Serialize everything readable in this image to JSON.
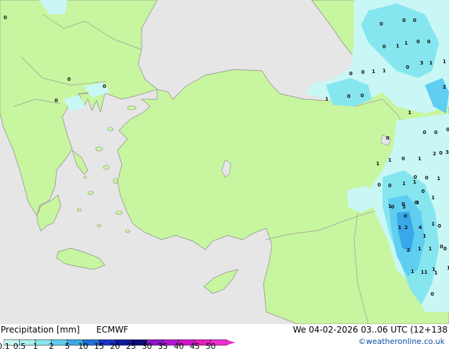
{
  "footer": {
    "title": "Precipitation [mm]",
    "model": "ECMWF",
    "valid_time": "We 04-02-2026 03..06 UTC (12+138",
    "credit": "©weatheronline.co.uk"
  },
  "legend": {
    "ticks": [
      "0.1",
      "0.5",
      "1",
      "2",
      "5",
      "10",
      "15",
      "20",
      "25",
      "30",
      "35",
      "40",
      "45",
      "50"
    ],
    "colors": [
      "#c8f7f5",
      "#aaf0ee",
      "#86e6f0",
      "#5fcef0",
      "#3aa8e8",
      "#1f6fd8",
      "#1832c8",
      "#0c1aa0",
      "#0a0a78",
      "#8c14c8",
      "#b414d2",
      "#d214c8",
      "#e61ebe",
      "#f02dd2"
    ]
  },
  "map_colors": {
    "sea": "#e6e6e6",
    "land": "#c8f5a0",
    "border": "#8a8a8a",
    "precip_light": "#c8f7f5",
    "precip_mid": "#86e6f0",
    "precip_heavy": "#5fcef0",
    "precip_strong": "#3aa8e8"
  },
  "map_labels": [
    "0",
    "0",
    "0",
    "0",
    "0",
    "0",
    "1",
    "1",
    "0",
    "0",
    "1",
    "0",
    "0",
    "0",
    "1",
    "1",
    "0",
    "3",
    "1",
    "2",
    "0",
    "0",
    "1",
    "0",
    "0",
    "1",
    "0",
    "0",
    "0",
    "2",
    "0",
    "3",
    "1",
    "1",
    "0",
    "1",
    "0",
    "0",
    "0",
    "1",
    "1",
    "0",
    "1",
    "0",
    "0",
    "0",
    "1",
    "1",
    "0",
    "5",
    "3",
    "1",
    "0",
    "1",
    "2",
    "4",
    "1",
    "0",
    "2",
    "1",
    "1",
    "0",
    "0",
    "1",
    "1",
    "0",
    "11",
    "1",
    "1"
  ]
}
